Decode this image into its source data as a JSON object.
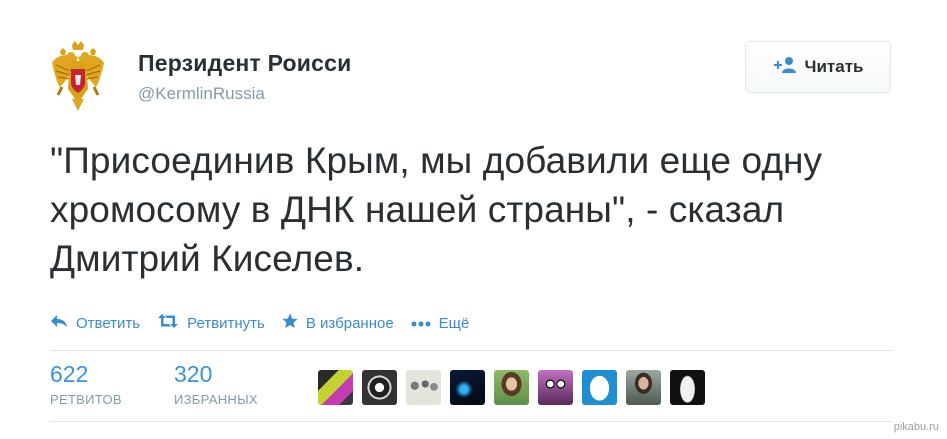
{
  "tweet": {
    "author_name": "Перзидент Роисси",
    "author_handle": "@KermlinRussia",
    "follow_label": "Читать",
    "text": "\"Присоединив Крым, мы добавили еще одну хромосому в ДНК нашей страны\", - сказал Дмитрий Киселев."
  },
  "actions": [
    {
      "label": "Ответить",
      "icon": "reply-icon"
    },
    {
      "label": "Ретвитнуть",
      "icon": "retweet-icon"
    },
    {
      "label": "В избранное",
      "icon": "star-icon"
    },
    {
      "label": "Ещё",
      "icon": "more-dots-icon"
    }
  ],
  "stats": {
    "retweets": {
      "value": "622",
      "label": "РЕТВИТОВ"
    },
    "favorites": {
      "value": "320",
      "label": "ИЗБРАННЫХ"
    }
  },
  "favoriter_avatars": [
    "avatar-colorful-stripes",
    "avatar-dark-emblem",
    "avatar-group-photo",
    "avatar-blue-night",
    "avatar-woman-portrait",
    "avatar-cartoon-face",
    "avatar-default-egg",
    "avatar-man-portrait",
    "avatar-statue"
  ],
  "colors": {
    "text": "#292f33",
    "link_blue": "#3a8dcc",
    "stat_blue": "#3b94d9",
    "muted_gray": "#8899a6",
    "border": "#e1e8ed"
  },
  "watermark": "pikabu.ru"
}
